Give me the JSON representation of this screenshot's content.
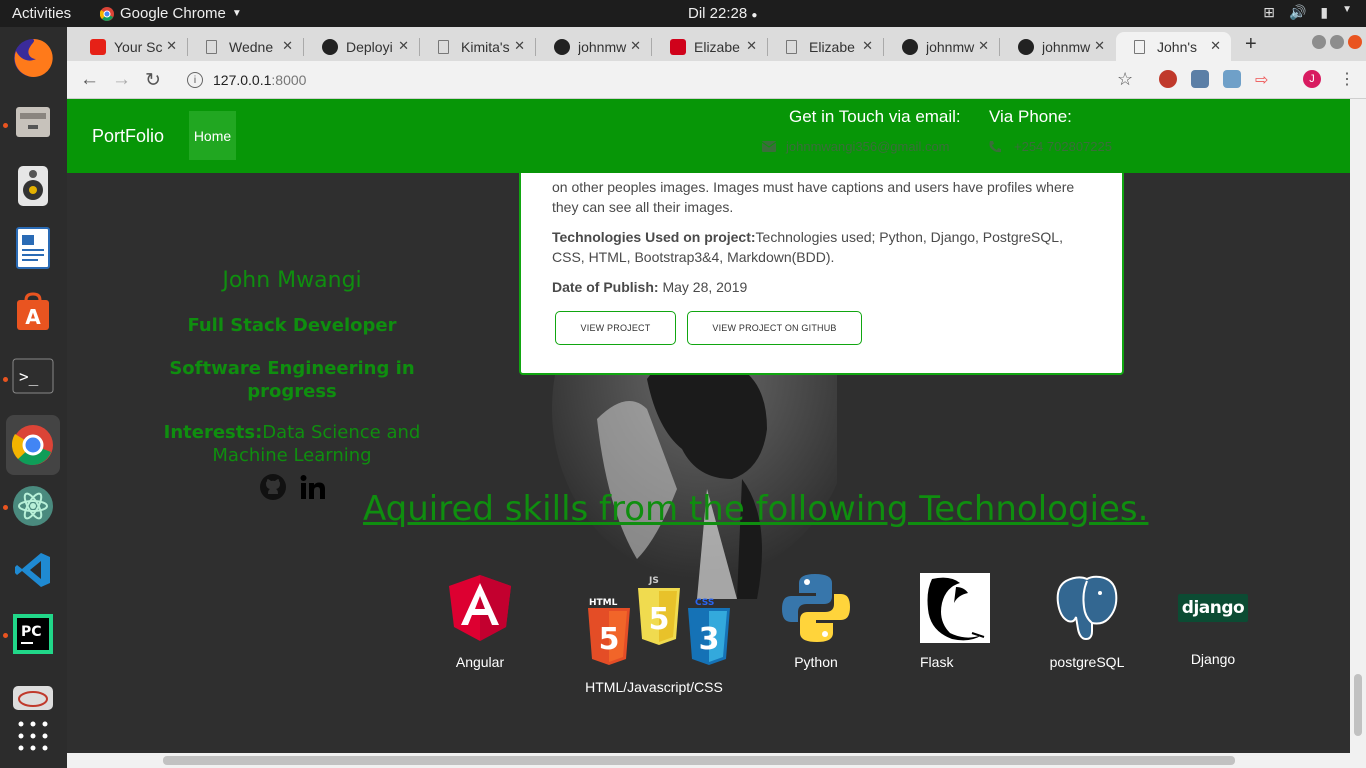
{
  "os": {
    "activities": "Activities",
    "app_name": "Google Chrome",
    "clock": "Dil 22:28"
  },
  "browser": {
    "tabs": [
      {
        "title": "Your Sc",
        "icon": "youtube-icon",
        "active": false
      },
      {
        "title": "Wedne",
        "icon": "blank-icon",
        "active": false
      },
      {
        "title": "Deployi",
        "icon": "github-icon",
        "active": false
      },
      {
        "title": "Kimita's",
        "icon": "document-icon",
        "active": false
      },
      {
        "title": "johnmw",
        "icon": "github-icon",
        "active": false
      },
      {
        "title": "Elizabe",
        "icon": "pdf-icon",
        "active": false
      },
      {
        "title": "Elizabe",
        "icon": "document-icon",
        "active": false
      },
      {
        "title": "johnmw",
        "icon": "github-icon",
        "active": false
      },
      {
        "title": "johnmw",
        "icon": "github-icon",
        "active": false
      },
      {
        "title": "John's",
        "icon": "document-icon",
        "active": true
      }
    ],
    "url_host": "127.0.0.1",
    "url_port": ":8000",
    "profile_initial": "J"
  },
  "navbar": {
    "brand": "PortFolio",
    "home": "Home",
    "email_heading": "Get in Touch via email:",
    "phone_heading": "Via Phone:",
    "email": "johnmwangi356@gmail.com",
    "phone": "+254 702807225"
  },
  "profile": {
    "name": "John Mwangi",
    "role": "Full Stack Developer",
    "status": "Software Engineering in progress",
    "interests_label": "Interests:",
    "interests_value": "Data Science and Machine Learning"
  },
  "project": {
    "description_tail": "on other peoples images. Images must have captions and users have profiles where they can see all their images.",
    "tech_label": "Technologies Used on project:",
    "tech_value": "Technologies used; Python, Django, PostgreSQL, CSS, HTML, Bootstrap3&4, Markdown(BDD).",
    "date_label": "Date of Publish:",
    "date_value": "May 28, 2019",
    "view_button": "VIEW PROJECT",
    "github_button": "VIEW PROJECT ON GITHUB"
  },
  "skills": {
    "heading": "Aquired skills from the following Technologies.",
    "items": [
      {
        "label": "Angular",
        "icon": "angular-icon"
      },
      {
        "label": "HTML/Javascript/CSS",
        "icon": "html-js-css-icon"
      },
      {
        "label": "Python",
        "icon": "python-icon"
      },
      {
        "label": "Flask",
        "icon": "flask-icon"
      },
      {
        "label": "postgreSQL",
        "icon": "postgresql-icon"
      },
      {
        "label": "Django",
        "icon": "django-icon"
      }
    ],
    "django_logo_text": "django",
    "html_logo_text": [
      "HTML",
      "JS",
      "CSS",
      "5",
      "3"
    ]
  },
  "colors": {
    "navbar": "#079607",
    "accent_green": "#0f8e0f",
    "page_bg": "#2f2f2f"
  }
}
